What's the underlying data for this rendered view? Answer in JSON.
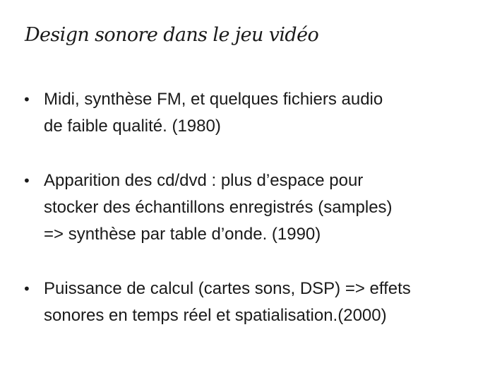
{
  "slide": {
    "title": "Design sonore dans le jeu vidéo",
    "bullets": [
      {
        "lines": [
          "Midi, synthèse FM, et quelques fichiers audio",
          "de faible qualité. (1980)"
        ]
      },
      {
        "lines": [
          "Apparition des cd/dvd : plus d’espace pour",
          "stocker des échantillons enregistrés (samples)",
          "=> synthèse par table d’onde. (1990)"
        ]
      },
      {
        "lines": [
          "Puissance de calcul (cartes sons, DSP) => effets",
          "sonores en temps réel et spatialisation.(2000)"
        ]
      }
    ]
  }
}
